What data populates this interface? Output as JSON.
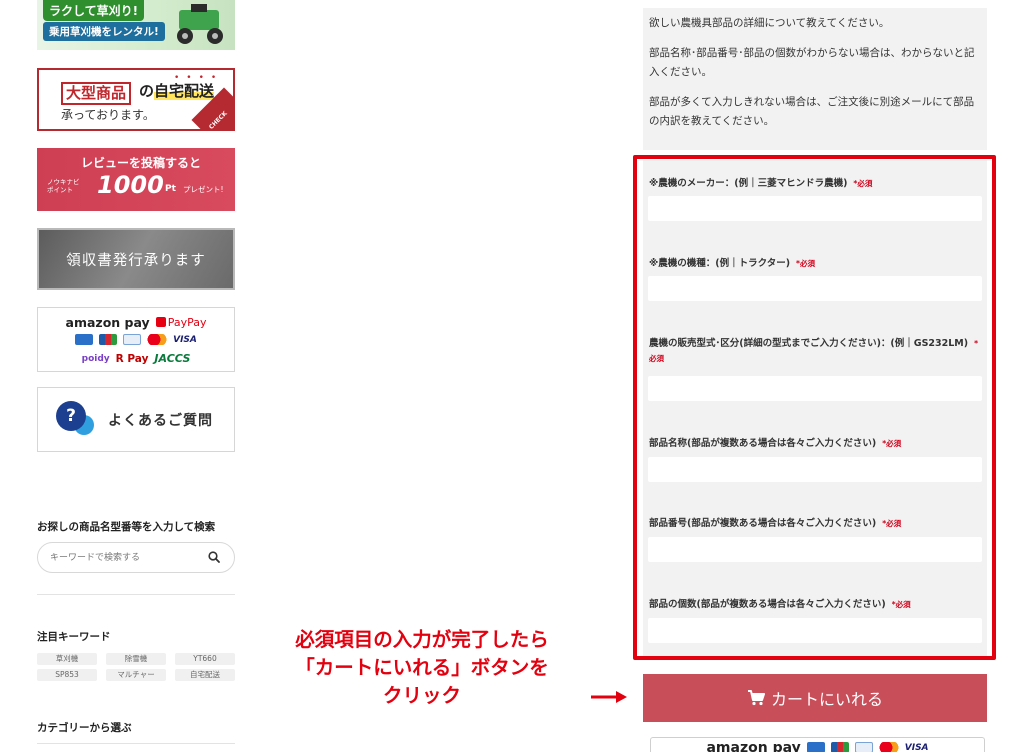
{
  "sidebar": {
    "banners": {
      "mower_title": "ラクして草刈り!",
      "mower_sub": "乗用草刈機をレンタル!",
      "large_boxed": "大型商品",
      "large_no": "の",
      "large_highlight": "自宅配送",
      "large_sub": "承っております。",
      "large_check": "CHECK",
      "review_line1": "レビューを投稿すると",
      "review_small": "ノウキナビ ポイント",
      "review_points": "1000",
      "review_pt": "Pt",
      "review_present": "プレゼント!",
      "receipt": "領収書発行承ります",
      "faq": "よくあるご質問"
    },
    "payments": {
      "amazon": "amazon pay",
      "paypay": "PayPay",
      "visa": "VISA",
      "poidy": "poidy",
      "rpay": "R Pay",
      "jaccs": "JACCS"
    },
    "search": {
      "heading": "お探しの商品名型番等を入力して検索",
      "placeholder": "キーワードで検索する"
    },
    "keywords": {
      "heading": "注目キーワード",
      "items": [
        "草刈機",
        "除雪機",
        "YT660",
        "SP853",
        "マルチャー",
        "自宅配送"
      ]
    },
    "category_heading": "カテゴリーから選ぶ"
  },
  "form": {
    "description": [
      "欲しい農機具部品の詳細について教えてください。",
      "部品名称･部品番号･部品の個数がわからない場合は、わからないと記入ください。",
      "部品が多くて入力しきれない場合は、ご注文後に別途メールにて部品の内訳を教えてください。"
    ],
    "required_mark": "*必須",
    "fields": [
      {
        "label": "※農機のメーカー：(例｜三菱マヒンドラ農機)"
      },
      {
        "label": "※農機の機種：(例｜トラクター)"
      },
      {
        "label": "農機の販売型式･区分(詳細の型式までご入力ください)：(例｜GS232LM)"
      },
      {
        "label": "部品名称(部品が複数ある場合は各々ご入力ください)"
      },
      {
        "label": "部品番号(部品が複数ある場合は各々ご入力ください)"
      },
      {
        "label": "部品の個数(部品が複数ある場合は各々ご入力ください)"
      }
    ]
  },
  "annotation": {
    "line1": "必須項目の入力が完了したら",
    "line2": "「カートにいれる」ボタンを",
    "line3": "クリック"
  },
  "cart_button": {
    "label": "カートにいれる"
  },
  "bottom_payments": {
    "amazon": "amazon pay",
    "visa": "VISA"
  },
  "colors": {
    "highlight_frame": "#e3000f",
    "cart_button": "#c84e5a",
    "required": "#d0021b"
  }
}
